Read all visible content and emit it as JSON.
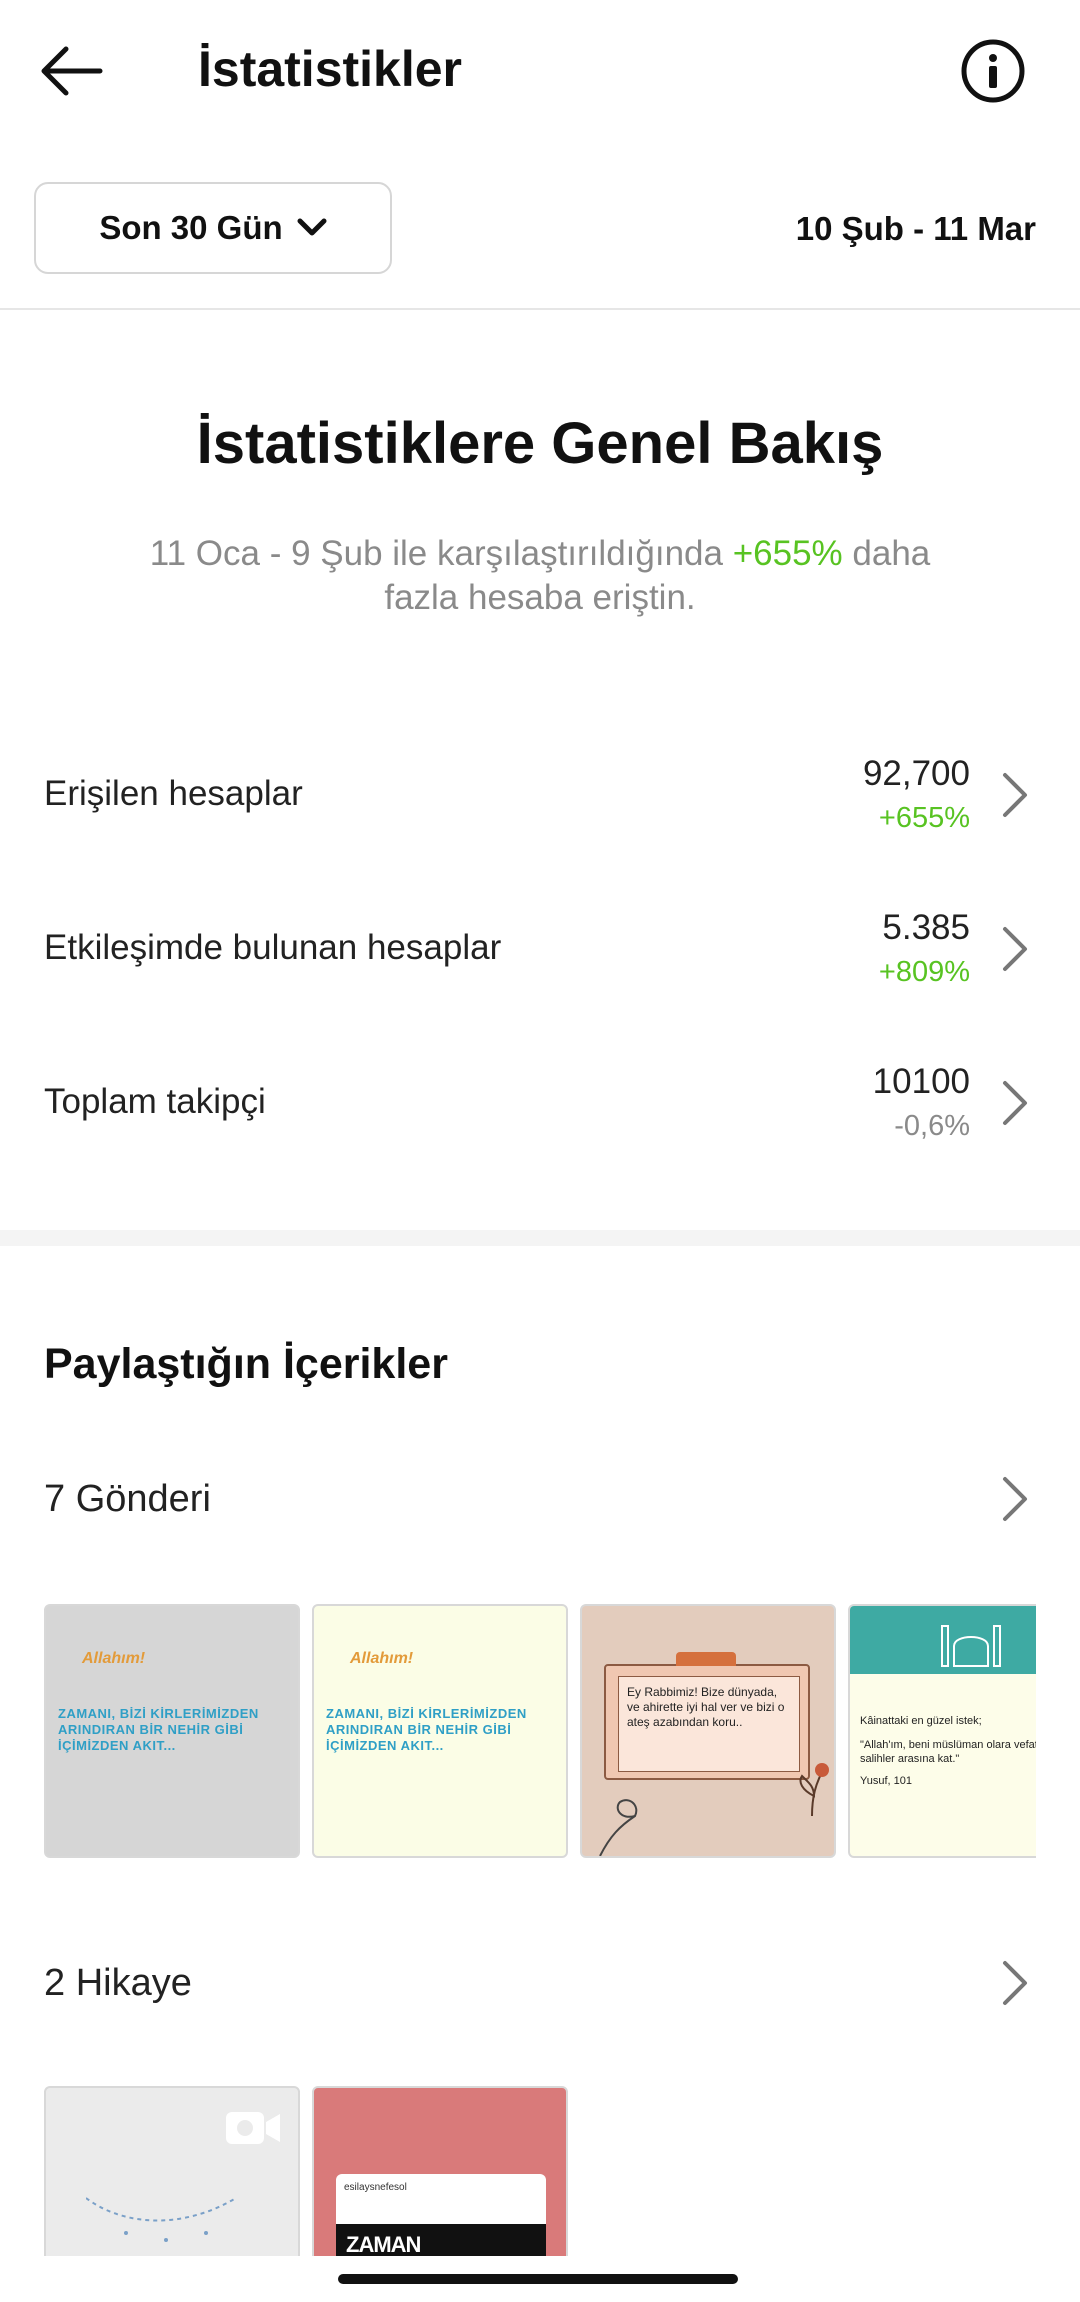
{
  "header": {
    "title": "İstatistikler",
    "back_icon": "arrow-left-icon",
    "info_icon": "info-icon"
  },
  "filter": {
    "range_label": "Son 30 Gün",
    "date_range": "10 Şub - 11 Mar"
  },
  "overview": {
    "title": "İstatistiklere Genel Bakış",
    "sub_prefix": "11 Oca - 9 Şub ile karşılaştırıldığında",
    "sub_pct": "+655%",
    "sub_suffix": "daha fazla hesaba eriştin."
  },
  "metrics": [
    {
      "label": "Erişilen hesaplar",
      "value": "92,700",
      "change": "+655%",
      "trend": "up"
    },
    {
      "label": "Etkileşimde bulunan hesaplar",
      "value": "5.385",
      "change": "+809%",
      "trend": "up"
    },
    {
      "label": "Toplam takipçi",
      "value": "10100",
      "change": "-0,6%",
      "trend": "neutral"
    }
  ],
  "content": {
    "title": "Paylaştığın İçerikler",
    "posts_label": "7 Gönderi",
    "stories_label": "2 Hikaye",
    "posts": [
      {
        "kicker": "Allahım!",
        "text": "ZAMANI, BİZİ KİRLERİMİZDEN ARINDIRAN BİR NEHİR GİBİ İÇİMİZDEN AKIT..."
      },
      {
        "kicker": "Allahım!",
        "text": "ZAMANI, BİZİ KİRLERİMİZDEN ARINDIRAN BİR NEHİR GİBİ İÇİMİZDEN AKIT..."
      },
      {
        "text": "Ey Rabbimiz! Bize dünyada, ve ahirette iyi hal ver ve bizi o ateş azabından koru.."
      },
      {
        "line1": "Kâinattaki en güzel istek;",
        "line2": "\"Allah'ım, beni müslüman olara vefat ettir ve beni salihler arasına kat.\"",
        "line3": "Yusuf, 101"
      }
    ],
    "stories": [
      {
        "type": "video"
      },
      {
        "handle": "esilaysnefesol",
        "headline": "ZAMAN DARALIYOR"
      }
    ]
  },
  "colors": {
    "positive": "#58c322",
    "muted": "#8a8a8a",
    "text": "#1a1a1a"
  }
}
